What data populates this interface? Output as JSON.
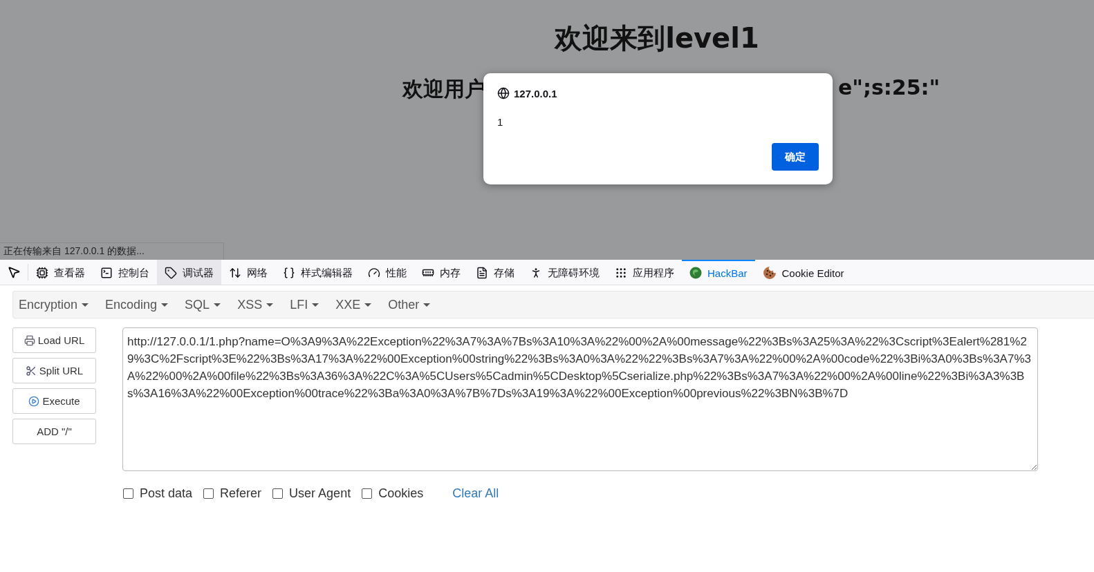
{
  "page": {
    "heading": "欢迎来到level1",
    "subheading_left": "欢迎用户",
    "subheading_right": "e\";s:25:\""
  },
  "dialog": {
    "origin": "127.0.0.1",
    "message": "1",
    "button": "确定"
  },
  "status_bar": "正在传输来自 127.0.0.1 的数据...",
  "devtools_tabs": [
    {
      "label": "查看器",
      "selected": false,
      "hovered": false
    },
    {
      "label": "控制台",
      "selected": false,
      "hovered": false
    },
    {
      "label": "调试器",
      "selected": false,
      "hovered": true
    },
    {
      "label": "网络",
      "selected": false,
      "hovered": false
    },
    {
      "label": "样式编辑器",
      "selected": false,
      "hovered": false
    },
    {
      "label": "性能",
      "selected": false,
      "hovered": false
    },
    {
      "label": "内存",
      "selected": false,
      "hovered": false
    },
    {
      "label": "存储",
      "selected": false,
      "hovered": false
    },
    {
      "label": "无障碍环境",
      "selected": false,
      "hovered": false
    },
    {
      "label": "应用程序",
      "selected": false,
      "hovered": false
    },
    {
      "label": "HackBar",
      "selected": true,
      "hovered": false
    },
    {
      "label": "Cookie Editor",
      "selected": false,
      "hovered": false
    }
  ],
  "hackbar": {
    "menus": [
      "Encryption",
      "Encoding",
      "SQL",
      "XSS",
      "LFI",
      "XXE",
      "Other"
    ],
    "buttons": [
      "Load URL",
      "Split URL",
      "Execute",
      "ADD \"/\""
    ],
    "url": "http://127.0.0.1/1.php?name=O%3A9%3A%22Exception%22%3A7%3A%7Bs%3A10%3A%22%00%2A%00message%22%3Bs%3A25%3A%22%3Cscript%3Ealert%281%29%3C%2Fscript%3E%22%3Bs%3A17%3A%22%00Exception%00string%22%3Bs%3A0%3A%22%22%3Bs%3A7%3A%22%00%2A%00code%22%3Bi%3A0%3Bs%3A7%3A%22%00%2A%00file%22%3Bs%3A36%3A%22C%3A%5CUsers%5Cadmin%5CDesktop%5Cserialize.php%22%3Bs%3A7%3A%22%00%2A%00line%22%3Bi%3A3%3Bs%3A16%3A%22%00Exception%00trace%22%3Ba%3A0%3A%7B%7Ds%3A19%3A%22%00Exception%00previous%22%3BN%3B%7D",
    "options": [
      {
        "label": "Post data",
        "checked": false
      },
      {
        "label": "Referer",
        "checked": false
      },
      {
        "label": "User Agent",
        "checked": false
      },
      {
        "label": "Cookies",
        "checked": false
      }
    ],
    "clear": "Clear All"
  }
}
